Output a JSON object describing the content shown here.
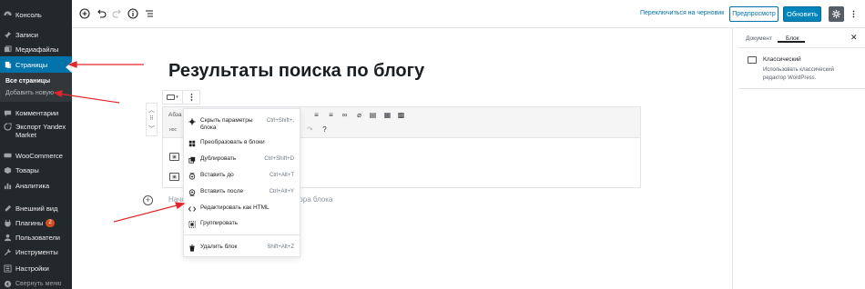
{
  "admin_menu": {
    "items": [
      {
        "label": "Консоль",
        "icon": "dashboard-icon"
      },
      {
        "label": "Записи",
        "icon": "pin-icon"
      },
      {
        "label": "Медиафайлы",
        "icon": "media-icon"
      },
      {
        "label": "Страницы",
        "icon": "pages-icon"
      },
      {
        "label": "Комментарии",
        "icon": "comment-icon"
      },
      {
        "label": "Экспорт Yandex Market",
        "icon": "export-icon"
      },
      {
        "label": "WooCommerce",
        "icon": "woocommerce-icon"
      },
      {
        "label": "Товары",
        "icon": "products-icon"
      },
      {
        "label": "Аналитика",
        "icon": "analytics-icon"
      },
      {
        "label": "Внешний вид",
        "icon": "appearance-icon"
      },
      {
        "label": "Плагины",
        "icon": "plugins-icon",
        "badge": "2"
      },
      {
        "label": "Пользователи",
        "icon": "users-icon"
      },
      {
        "label": "Инструменты",
        "icon": "tools-icon"
      },
      {
        "label": "Настройки",
        "icon": "settings-icon"
      },
      {
        "label": "Свернуть меню",
        "icon": "collapse-icon"
      }
    ],
    "submenu": [
      "Все страницы",
      "Добавить новую"
    ]
  },
  "toolbar": {
    "draft_link": "Переключиться на черновик",
    "preview": "Предпросмотр",
    "publish": "Обновить"
  },
  "editor": {
    "title": "Результаты поиска по блогу",
    "block_format": "Абза",
    "small_label": "нос",
    "appender_text": "Начните писать или введите / для выбора блока"
  },
  "block_menu": {
    "items": [
      {
        "label": "Скрыть параметры блока",
        "shortcut": "Ctrl+Shift+,",
        "icon": "gear-icon"
      },
      {
        "label": "Преобразовать в блоки",
        "shortcut": "",
        "icon": "grid-icon"
      },
      {
        "label": "Дублировать",
        "shortcut": "Ctrl+Shift+D",
        "icon": "duplicate-icon"
      },
      {
        "label": "Вставить до",
        "shortcut": "Ctrl+Alt+T",
        "icon": "insert-before-icon"
      },
      {
        "label": "Вставить после",
        "shortcut": "Ctrl+Alt+Y",
        "icon": "insert-after-icon"
      },
      {
        "label": "Редактировать как HTML",
        "shortcut": "",
        "icon": "html-icon"
      },
      {
        "label": "Группировать",
        "shortcut": "",
        "icon": "group-icon"
      },
      {
        "label": "Удалить блок",
        "shortcut": "Shift+Alt+Z",
        "icon": "trash-icon"
      }
    ]
  },
  "settings_panel": {
    "tabs": [
      "Документ",
      "Блок"
    ],
    "active_tab": "Блок",
    "block_title": "Классический",
    "block_description": "Использовать классический редактор WordPress."
  },
  "colors": {
    "admin_bg": "#23282d",
    "admin_current": "#0073aa",
    "primary_button": "#0085ba",
    "annotation_arrow": "#e3262b"
  }
}
